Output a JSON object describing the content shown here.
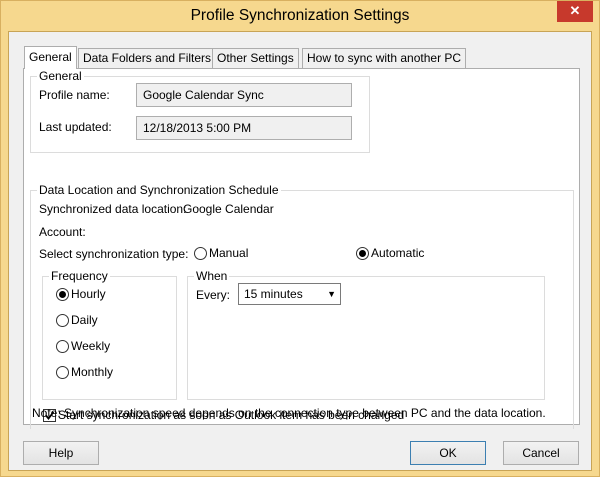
{
  "window": {
    "title": "Profile Synchronization Settings",
    "close_glyph": "✕"
  },
  "tabs": [
    "General",
    "Data Folders and Filters",
    "Other Settings",
    "How to sync with another PC"
  ],
  "general_group": {
    "legend": "General",
    "profile_name_label": "Profile name:",
    "profile_name_value": "Google Calendar Sync",
    "last_updated_label": "Last updated:",
    "last_updated_value": "12/18/2013 5:00 PM"
  },
  "data_group": {
    "legend": "Data Location and Synchronization Schedule",
    "synced_location_label": "Synchronized data location:",
    "synced_location_value": "Google Calendar",
    "account_label": "Account:",
    "sync_type_label": "Select synchronization type:",
    "manual_label": "Manual",
    "automatic_label": "Automatic",
    "selected_type": "Automatic"
  },
  "frequency": {
    "legend": "Frequency",
    "options": [
      "Hourly",
      "Daily",
      "Weekly",
      "Monthly"
    ],
    "selected": "Hourly"
  },
  "when": {
    "legend": "When",
    "every_label": "Every:",
    "every_value": "15 minutes"
  },
  "start_on_change": {
    "label": "Start synchronization as soon as Outlook item has been changed",
    "checked": true
  },
  "note": "Note: Synchronization speed depends on the connection type between PC and the data location.",
  "buttons": {
    "help": "Help",
    "ok": "OK",
    "cancel": "Cancel"
  }
}
